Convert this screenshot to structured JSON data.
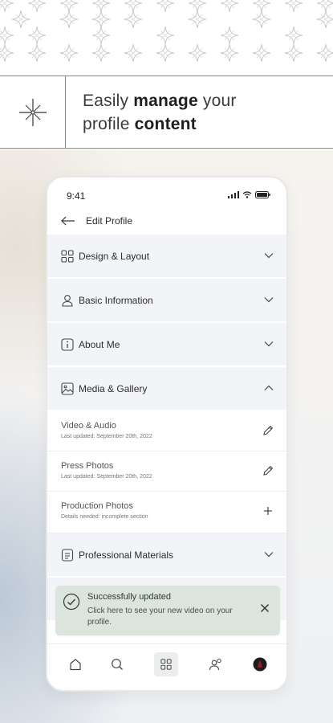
{
  "headline": {
    "part1": "Easily ",
    "bold1": "manage",
    "part2": " your",
    "part3": "profile ",
    "bold2": "content"
  },
  "status": {
    "time": "9:41"
  },
  "header": {
    "title": "Edit Profile"
  },
  "sections": [
    {
      "label": "Design & Layout",
      "icon": "grid-icon",
      "expanded": false
    },
    {
      "label": "Basic Information",
      "icon": "person-icon",
      "expanded": false
    },
    {
      "label": "About Me",
      "icon": "info-icon",
      "expanded": false
    },
    {
      "label": "Media & Gallery",
      "icon": "image-icon",
      "expanded": true
    },
    {
      "label": "Professional Materials",
      "icon": "document-icon",
      "expanded": false
    }
  ],
  "media_items": [
    {
      "title": "Video & Audio",
      "subtitle": "Last updated: September 20th, 2022",
      "action": "pencil-icon"
    },
    {
      "title": "Press Photos",
      "subtitle": "Last updated: September 20th, 2022",
      "action": "pencil-icon"
    },
    {
      "title": "Production Photos",
      "subtitle": "Details needed: incomplete section",
      "action": "plus-icon"
    }
  ],
  "toast": {
    "title": "Successfully updated",
    "message": "Click here to see your new video on your profile."
  },
  "bottom_nav": [
    "home-icon",
    "search-icon",
    "grid-icon",
    "people-icon",
    "avatar"
  ],
  "colors": {
    "section_bg": "#f2f4f7",
    "toast_bg": "#dbe5dd",
    "line": "#8a8a8a"
  }
}
